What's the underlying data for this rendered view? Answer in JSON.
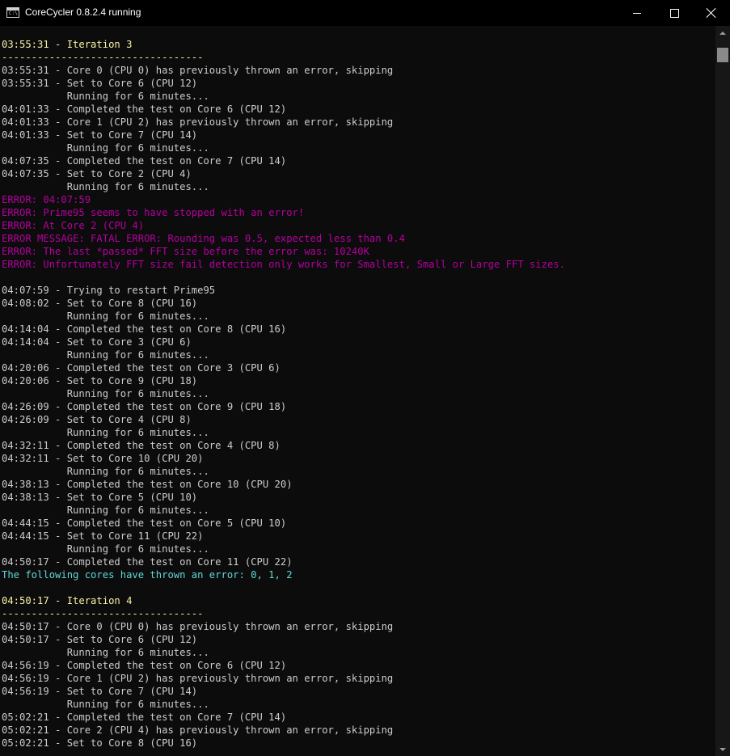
{
  "window": {
    "title": "CoreCycler 0.8.2.4 running",
    "icon": "console-icon",
    "colors": {
      "background": "#0c0c0c",
      "default_text": "#cccccc",
      "yellow": "#f9f1a5",
      "magenta": "#b4009e",
      "cyan": "#61d6d6"
    }
  },
  "console_lines": [
    {
      "text": "03:55:31 - Iteration 3",
      "color": "yellow"
    },
    {
      "text": "----------------------------------",
      "color": "yellow"
    },
    {
      "text": "03:55:31 - Core 0 (CPU 0) has previously thrown an error, skipping",
      "color": "default"
    },
    {
      "text": "03:55:31 - Set to Core 6 (CPU 12)",
      "color": "default"
    },
    {
      "text": "           Running for 6 minutes...",
      "color": "default"
    },
    {
      "text": "04:01:33 - Completed the test on Core 6 (CPU 12)",
      "color": "default"
    },
    {
      "text": "04:01:33 - Core 1 (CPU 2) has previously thrown an error, skipping",
      "color": "default"
    },
    {
      "text": "04:01:33 - Set to Core 7 (CPU 14)",
      "color": "default"
    },
    {
      "text": "           Running for 6 minutes...",
      "color": "default"
    },
    {
      "text": "04:07:35 - Completed the test on Core 7 (CPU 14)",
      "color": "default"
    },
    {
      "text": "04:07:35 - Set to Core 2 (CPU 4)",
      "color": "default"
    },
    {
      "text": "           Running for 6 minutes...",
      "color": "default"
    },
    {
      "text": "ERROR: 04:07:59",
      "color": "magenta"
    },
    {
      "text": "ERROR: Prime95 seems to have stopped with an error!",
      "color": "magenta"
    },
    {
      "text": "ERROR: At Core 2 (CPU 4)",
      "color": "magenta"
    },
    {
      "text": "ERROR MESSAGE: FATAL ERROR: Rounding was 0.5, expected less than 0.4",
      "color": "magenta"
    },
    {
      "text": "ERROR: The last *passed* FFT size before the error was: 10240K",
      "color": "magenta"
    },
    {
      "text": "ERROR: Unfortunately FFT size fail detection only works for Smallest, Small or Large FFT sizes.",
      "color": "magenta"
    },
    {
      "text": "",
      "color": "default"
    },
    {
      "text": "04:07:59 - Trying to restart Prime95",
      "color": "default"
    },
    {
      "text": "04:08:02 - Set to Core 8 (CPU 16)",
      "color": "default"
    },
    {
      "text": "           Running for 6 minutes...",
      "color": "default"
    },
    {
      "text": "04:14:04 - Completed the test on Core 8 (CPU 16)",
      "color": "default"
    },
    {
      "text": "04:14:04 - Set to Core 3 (CPU 6)",
      "color": "default"
    },
    {
      "text": "           Running for 6 minutes...",
      "color": "default"
    },
    {
      "text": "04:20:06 - Completed the test on Core 3 (CPU 6)",
      "color": "default"
    },
    {
      "text": "04:20:06 - Set to Core 9 (CPU 18)",
      "color": "default"
    },
    {
      "text": "           Running for 6 minutes...",
      "color": "default"
    },
    {
      "text": "04:26:09 - Completed the test on Core 9 (CPU 18)",
      "color": "default"
    },
    {
      "text": "04:26:09 - Set to Core 4 (CPU 8)",
      "color": "default"
    },
    {
      "text": "           Running for 6 minutes...",
      "color": "default"
    },
    {
      "text": "04:32:11 - Completed the test on Core 4 (CPU 8)",
      "color": "default"
    },
    {
      "text": "04:32:11 - Set to Core 10 (CPU 20)",
      "color": "default"
    },
    {
      "text": "           Running for 6 minutes...",
      "color": "default"
    },
    {
      "text": "04:38:13 - Completed the test on Core 10 (CPU 20)",
      "color": "default"
    },
    {
      "text": "04:38:13 - Set to Core 5 (CPU 10)",
      "color": "default"
    },
    {
      "text": "           Running for 6 minutes...",
      "color": "default"
    },
    {
      "text": "04:44:15 - Completed the test on Core 5 (CPU 10)",
      "color": "default"
    },
    {
      "text": "04:44:15 - Set to Core 11 (CPU 22)",
      "color": "default"
    },
    {
      "text": "           Running for 6 minutes...",
      "color": "default"
    },
    {
      "text": "04:50:17 - Completed the test on Core 11 (CPU 22)",
      "color": "default"
    },
    {
      "text": "The following cores have thrown an error: 0, 1, 2",
      "color": "cyan"
    },
    {
      "text": "",
      "color": "default"
    },
    {
      "text": "04:50:17 - Iteration 4",
      "color": "yellow"
    },
    {
      "text": "----------------------------------",
      "color": "yellow"
    },
    {
      "text": "04:50:17 - Core 0 (CPU 0) has previously thrown an error, skipping",
      "color": "default"
    },
    {
      "text": "04:50:17 - Set to Core 6 (CPU 12)",
      "color": "default"
    },
    {
      "text": "           Running for 6 minutes...",
      "color": "default"
    },
    {
      "text": "04:56:19 - Completed the test on Core 6 (CPU 12)",
      "color": "default"
    },
    {
      "text": "04:56:19 - Core 1 (CPU 2) has previously thrown an error, skipping",
      "color": "default"
    },
    {
      "text": "04:56:19 - Set to Core 7 (CPU 14)",
      "color": "default"
    },
    {
      "text": "           Running for 6 minutes...",
      "color": "default"
    },
    {
      "text": "05:02:21 - Completed the test on Core 7 (CPU 14)",
      "color": "default"
    },
    {
      "text": "05:02:21 - Core 2 (CPU 4) has previously thrown an error, skipping",
      "color": "default"
    },
    {
      "text": "05:02:21 - Set to Core 8 (CPU 16)",
      "color": "default"
    }
  ],
  "scrollbar": {
    "position_fraction": 0.0
  }
}
